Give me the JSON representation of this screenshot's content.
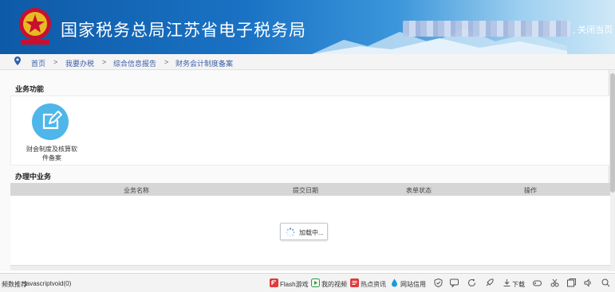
{
  "header": {
    "title": "国家税务总局江苏省电子税务局",
    "close_label": "关闭当页"
  },
  "breadcrumb": [
    "首页",
    "我要办税",
    "综合信息报告",
    "财务会计制度备案"
  ],
  "business_functions": {
    "title": "业务功能",
    "items": [
      {
        "label": "财会制度及核算软件备案",
        "icon": "edit-icon"
      }
    ]
  },
  "in_progress": {
    "title": "办理中业务",
    "columns": [
      "业务名称",
      "提交日期",
      "表单状态",
      "操作"
    ],
    "loading_text": "加载中..."
  },
  "statusbar": {
    "left_text": "频数推荐",
    "url": "javascriptvoid(0)",
    "items": [
      "Flash游戏",
      "我的视频",
      "热点资讯",
      "网站信用",
      "下载"
    ]
  },
  "colors": {
    "header": "#1a72c4",
    "icon_circle": "#4fb6ea",
    "link": "#3b5fa6"
  }
}
